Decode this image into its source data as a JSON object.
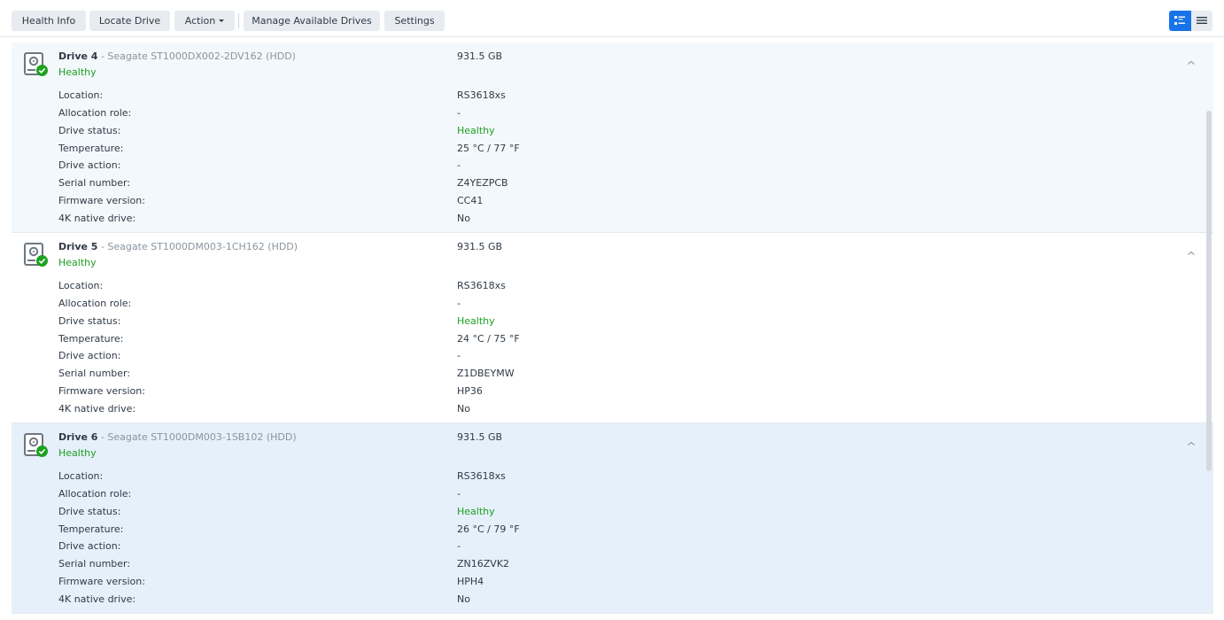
{
  "toolbar": {
    "health_info": "Health Info",
    "locate_drive": "Locate Drive",
    "action": "Action",
    "manage_available_drives": "Manage Available Drives",
    "settings": "Settings",
    "view_modes": [
      "list-detail-icon",
      "list-compact-icon"
    ],
    "active_view": "list-detail-icon"
  },
  "colors": {
    "accent": "#1873e8",
    "healthy": "#1ea021",
    "selected_row": "#e5f0fb"
  },
  "labels": {
    "location": "Location:",
    "allocation_role": "Allocation role:",
    "drive_status": "Drive status:",
    "temperature": "Temperature:",
    "drive_action": "Drive action:",
    "serial_number": "Serial number:",
    "firmware_version": "Firmware version:",
    "native_4k": "4K native drive:"
  },
  "drives": [
    {
      "name": "Drive 4",
      "model": " - Seagate ST1000DX002-2DV162 (HDD)",
      "health": "Healthy",
      "capacity": "931.5 GB",
      "location": "RS3618xs",
      "allocation_role": "-",
      "drive_status": "Healthy",
      "temperature": "25 °C / 77 °F",
      "drive_action": "-",
      "serial_number": "Z4YEZPCB",
      "firmware_version": "CC41",
      "native_4k": "No"
    },
    {
      "name": "Drive 5",
      "model": " - Seagate ST1000DM003-1CH162 (HDD)",
      "health": "Healthy",
      "capacity": "931.5 GB",
      "location": "RS3618xs",
      "allocation_role": "-",
      "drive_status": "Healthy",
      "temperature": "24 °C / 75 °F",
      "drive_action": "-",
      "serial_number": "Z1DBEYMW",
      "firmware_version": "HP36",
      "native_4k": "No"
    },
    {
      "name": "Drive 6",
      "model": " - Seagate ST1000DM003-1SB102 (HDD)",
      "health": "Healthy",
      "capacity": "931.5 GB",
      "location": "RS3618xs",
      "allocation_role": "-",
      "drive_status": "Healthy",
      "temperature": "26 °C / 79 °F",
      "drive_action": "-",
      "serial_number": "ZN16ZVK2",
      "firmware_version": "HPH4",
      "native_4k": "No"
    }
  ]
}
